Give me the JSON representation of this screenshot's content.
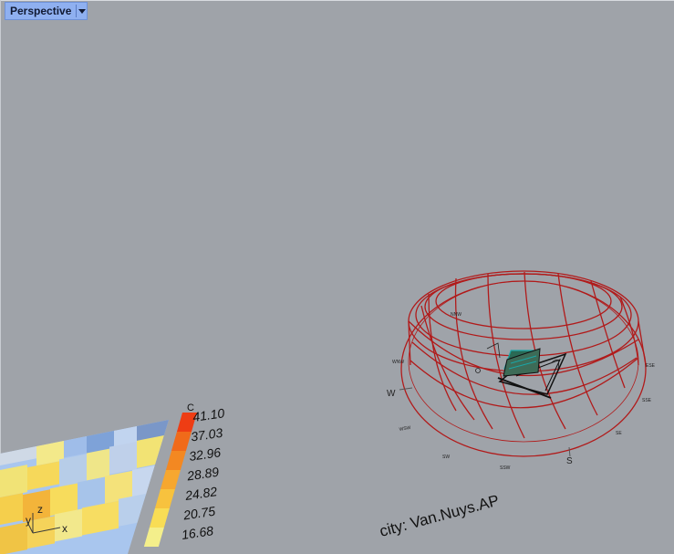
{
  "viewport": {
    "tab_label": "Perspective",
    "tab_menu_icon": "triangle-down-icon"
  },
  "legend": {
    "title": "C",
    "values": [
      "41.10",
      "37.03",
      "32.96",
      "28.89",
      "24.82",
      "20.75",
      "16.68"
    ],
    "colors": [
      "#ee3d14",
      "#f06a1a",
      "#f38822",
      "#f6a72f",
      "#f7c23e",
      "#f8dd55",
      "#f4ef8b"
    ]
  },
  "axes_gizmo": {
    "labels": [
      "y",
      "z",
      "x"
    ]
  },
  "sunpath": {
    "city_label": "city: Van.Nuys.AP",
    "directions": [
      "W",
      "S",
      "WSW",
      "SSW",
      "SW",
      "SE",
      "SSE",
      "ESE",
      "NNW",
      "WNW"
    ],
    "colors": {
      "dome": "#b11a1a",
      "model": "#111111",
      "accent": "#1aa6a6"
    }
  }
}
